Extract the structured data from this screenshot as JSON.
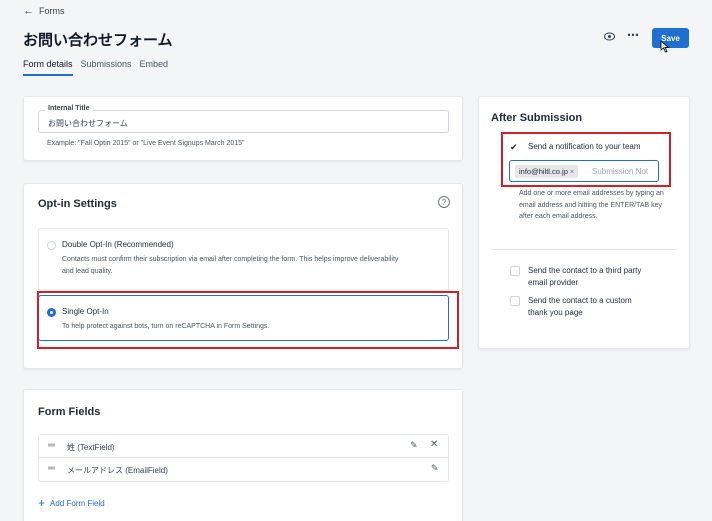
{
  "header": {
    "back_label": "Forms",
    "title": "お問い合わせフォーム",
    "tabs": [
      "Form details",
      "Submissions",
      "Embed"
    ],
    "save_label": "Save",
    "more_icon": "⋯",
    "accent": "#1f6fd1"
  },
  "internal_title": {
    "label": "Internal Title",
    "value": "お問い合わせフォーム",
    "hint": "Example: \"Fall Optin 2015\" or \"Live Event Signups March 2015\""
  },
  "optin": {
    "title": "Opt-in Settings",
    "help": "?",
    "double_label": "Double Opt-In (Recommended)",
    "double_desc_1": "Contacts must confirm their subscription via email after completing the form. This helps improve deliverability",
    "double_desc_2": "and lead quality.",
    "single_label": "Single Opt-In",
    "single_desc": "To help protect against bots, turn on reCAPTCHA in Form Settings.",
    "selected": "single"
  },
  "form_fields": {
    "title": "Form Fields",
    "rows": [
      {
        "label": "姓 (TextField)"
      },
      {
        "label": "メールアドレス (EmailField)"
      }
    ],
    "add_label": "Add Form Field"
  },
  "after": {
    "title": "After Submission",
    "notify_label": "Send a notification to your team",
    "notify_checked": true,
    "email_tag": "info@hiltl.co.jp",
    "email_placeholder": "Submission Not",
    "email_hint": "Add one or more email addresses by typing an email address and hitting the ENTER/TAB key after each email address.",
    "option2_line1": "Send the contact to a third party",
    "option2_line2": "email provider",
    "option3_line1": "Send the contact to a custom",
    "option3_line2": "thank you page"
  },
  "highlight_color": "#d0202a"
}
